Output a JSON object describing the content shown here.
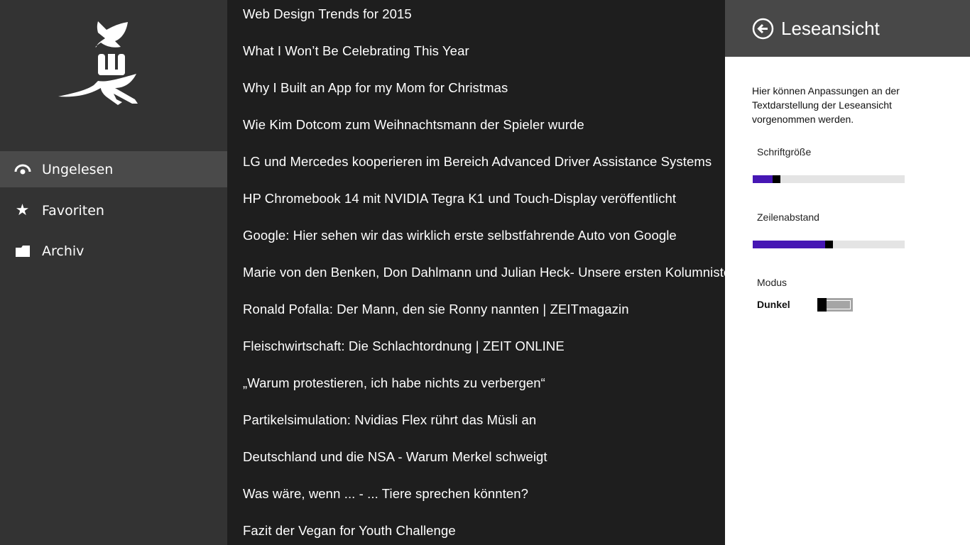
{
  "sidebar": {
    "items": [
      {
        "label": "Ungelesen",
        "icon": "eye-icon",
        "selected": true
      },
      {
        "label": "Favoriten",
        "icon": "star-icon",
        "selected": false
      },
      {
        "label": "Archiv",
        "icon": "folder-icon",
        "selected": false
      }
    ]
  },
  "articles": [
    "Web Design Trends for 2015",
    "What I Won’t Be Celebrating This Year",
    "Why I Built an App for my Mom for Christmas",
    "Wie Kim Dotcom zum Weihnachtsmann der Spieler wurde",
    "LG und Mercedes kooperieren im Bereich Advanced Driver Assistance Systems",
    "HP Chromebook 14 mit NVIDIA Tegra K1 und Touch-Display veröffentlicht",
    "Google: Hier sehen wir das wirklich erste selbstfahrende Auto von Google",
    "Marie von den Benken, Don Dahlmann und Julian Heck- Unsere ersten Kolumnisten",
    "Ronald Pofalla: Der Mann, den sie Ronny nannten | ZEITmagazin",
    "Fleischwirtschaft: Die Schlachtordnung | ZEIT ONLINE",
    "„Warum protestieren, ich habe nichts zu verbergen“",
    "Partikelsimulation: Nvidias Flex rührt das Müsli an",
    "Deutschland und die NSA - Warum Merkel schweigt",
    "Was wäre, wenn ... - ... Tiere sprechen könnten?",
    "Fazit der Vegan for Youth Challenge"
  ],
  "panel": {
    "title": "Leseansicht",
    "description": "Hier können Anpassungen an der Textdarstellung der Leseansicht vorgenommen werden.",
    "font_size": {
      "label": "Schriftgröße",
      "value_percent": 14
    },
    "line_spacing": {
      "label": "Zeilenabstand",
      "value_percent": 50
    },
    "mode": {
      "label": "Modus",
      "value": "Dunkel",
      "on": false
    }
  },
  "colors": {
    "accent": "#4617b4",
    "sidebar": "#333333",
    "list_bg": "#1e1e1e",
    "panel_header": "#484848"
  }
}
